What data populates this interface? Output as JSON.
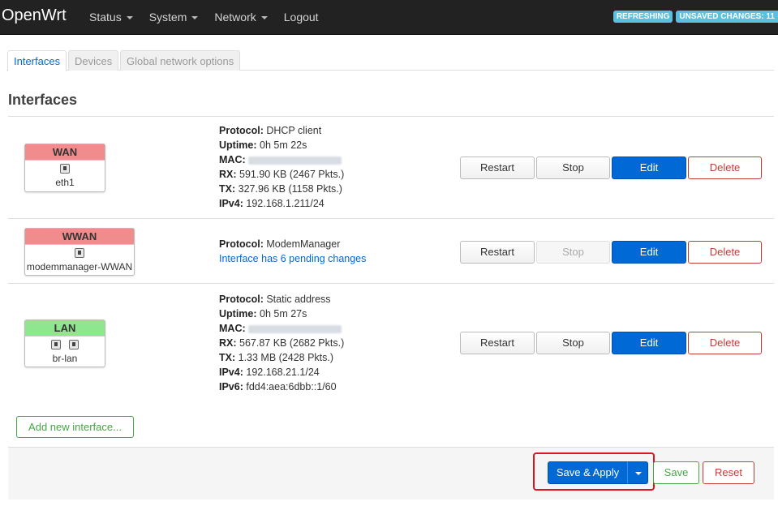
{
  "app": {
    "brand": "OpenWrt"
  },
  "nav": {
    "items": [
      {
        "label": "Status",
        "dropdown": true
      },
      {
        "label": "System",
        "dropdown": true
      },
      {
        "label": "Network",
        "dropdown": true
      },
      {
        "label": "Logout",
        "dropdown": false
      }
    ]
  },
  "status_badges": {
    "refreshing": "REFRESHING",
    "unsaved": "UNSAVED CHANGES: 11"
  },
  "tabs": [
    {
      "label": "Interfaces",
      "active": true
    },
    {
      "label": "Devices",
      "active": false
    },
    {
      "label": "Global network options",
      "active": false
    }
  ],
  "page_title": "Interfaces",
  "interfaces": [
    {
      "name": "WAN",
      "color": "#f08c8c",
      "device": "eth1",
      "protocol_label": "Protocol:",
      "protocol": "DHCP client",
      "uptime_label": "Uptime:",
      "uptime": "0h 5m 22s",
      "mac_label": "MAC:",
      "rx_label": "RX:",
      "rx": "591.90 KB (2467 Pkts.)",
      "tx_label": "TX:",
      "tx": "327.96 KB (1158 Pkts.)",
      "ipv4_label": "IPv4:",
      "ipv4": "192.168.1.211/24"
    },
    {
      "name": "WWAN",
      "color": "#f08c8c",
      "device": "modemmanager-WWAN",
      "protocol_label": "Protocol:",
      "protocol": "ModemManager",
      "pending": "Interface has 6 pending changes"
    },
    {
      "name": "LAN",
      "color": "#8ee68e",
      "device": "br-lan",
      "protocol_label": "Protocol:",
      "protocol": "Static address",
      "uptime_label": "Uptime:",
      "uptime": "0h 5m 27s",
      "mac_label": "MAC:",
      "rx_label": "RX:",
      "rx": "567.87 KB (2682 Pkts.)",
      "tx_label": "TX:",
      "tx": "1.33 MB (2428 Pkts.)",
      "ipv4_label": "IPv4:",
      "ipv4": "192.168.21.1/24",
      "ipv6_label": "IPv6:",
      "ipv6": "fdd4:aea:6dbb::1/60"
    }
  ],
  "row_buttons": {
    "restart": "Restart",
    "stop": "Stop",
    "edit": "Edit",
    "delete": "Delete"
  },
  "add_interface": "Add new interface...",
  "footer": {
    "save_apply": "Save & Apply",
    "save": "Save",
    "reset": "Reset"
  }
}
